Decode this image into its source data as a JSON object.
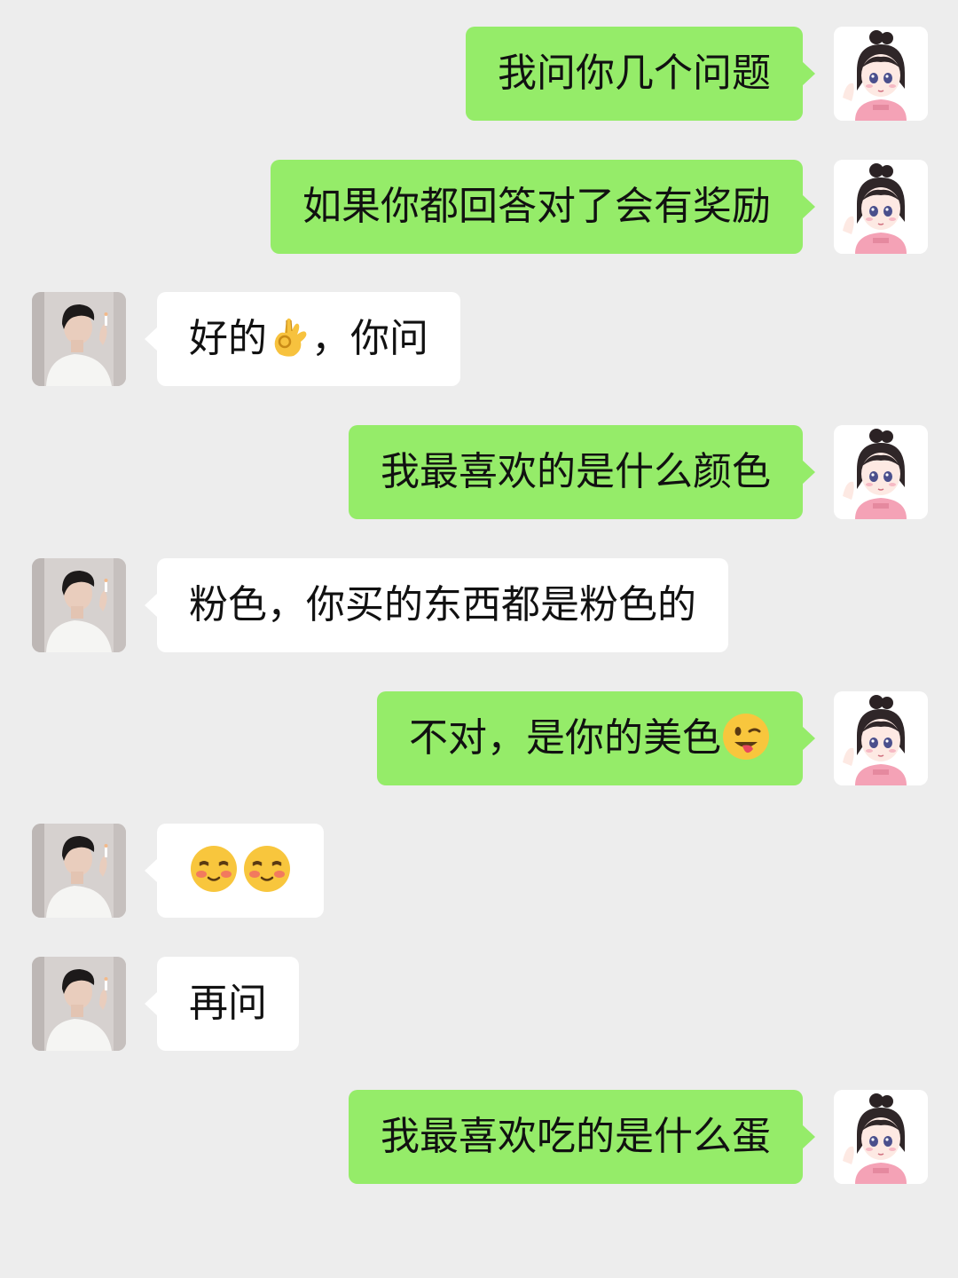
{
  "chat": {
    "colors": {
      "background": "#ededed",
      "sent_bubble": "#95ec69",
      "received_bubble": "#ffffff"
    },
    "messages": [
      {
        "side": "right",
        "text": "我问你几个问题",
        "avatar_icon": "girl-avatar-icon"
      },
      {
        "side": "right",
        "text": "如果你都回答对了会有奖励",
        "avatar_icon": "girl-avatar-icon"
      },
      {
        "side": "left",
        "text_before": "好的",
        "emoji": "ok-hand-emoji",
        "text_after": "，你问",
        "avatar_icon": "boy-avatar-icon"
      },
      {
        "side": "right",
        "text": "我最喜欢的是什么颜色",
        "avatar_icon": "girl-avatar-icon"
      },
      {
        "side": "left",
        "text": "粉色，你买的东西都是粉色的",
        "avatar_icon": "boy-avatar-icon"
      },
      {
        "side": "right",
        "text_before": "不对，是你的美色",
        "emoji": "winking-tongue-emoji",
        "avatar_icon": "girl-avatar-icon"
      },
      {
        "side": "left",
        "emojis": [
          "blushing-smile-emoji",
          "blushing-smile-emoji"
        ],
        "avatar_icon": "boy-avatar-icon"
      },
      {
        "side": "left",
        "text": "再问",
        "avatar_icon": "boy-avatar-icon"
      },
      {
        "side": "right",
        "text": "我最喜欢吃的是什么蛋",
        "avatar_icon": "girl-avatar-icon"
      }
    ]
  }
}
